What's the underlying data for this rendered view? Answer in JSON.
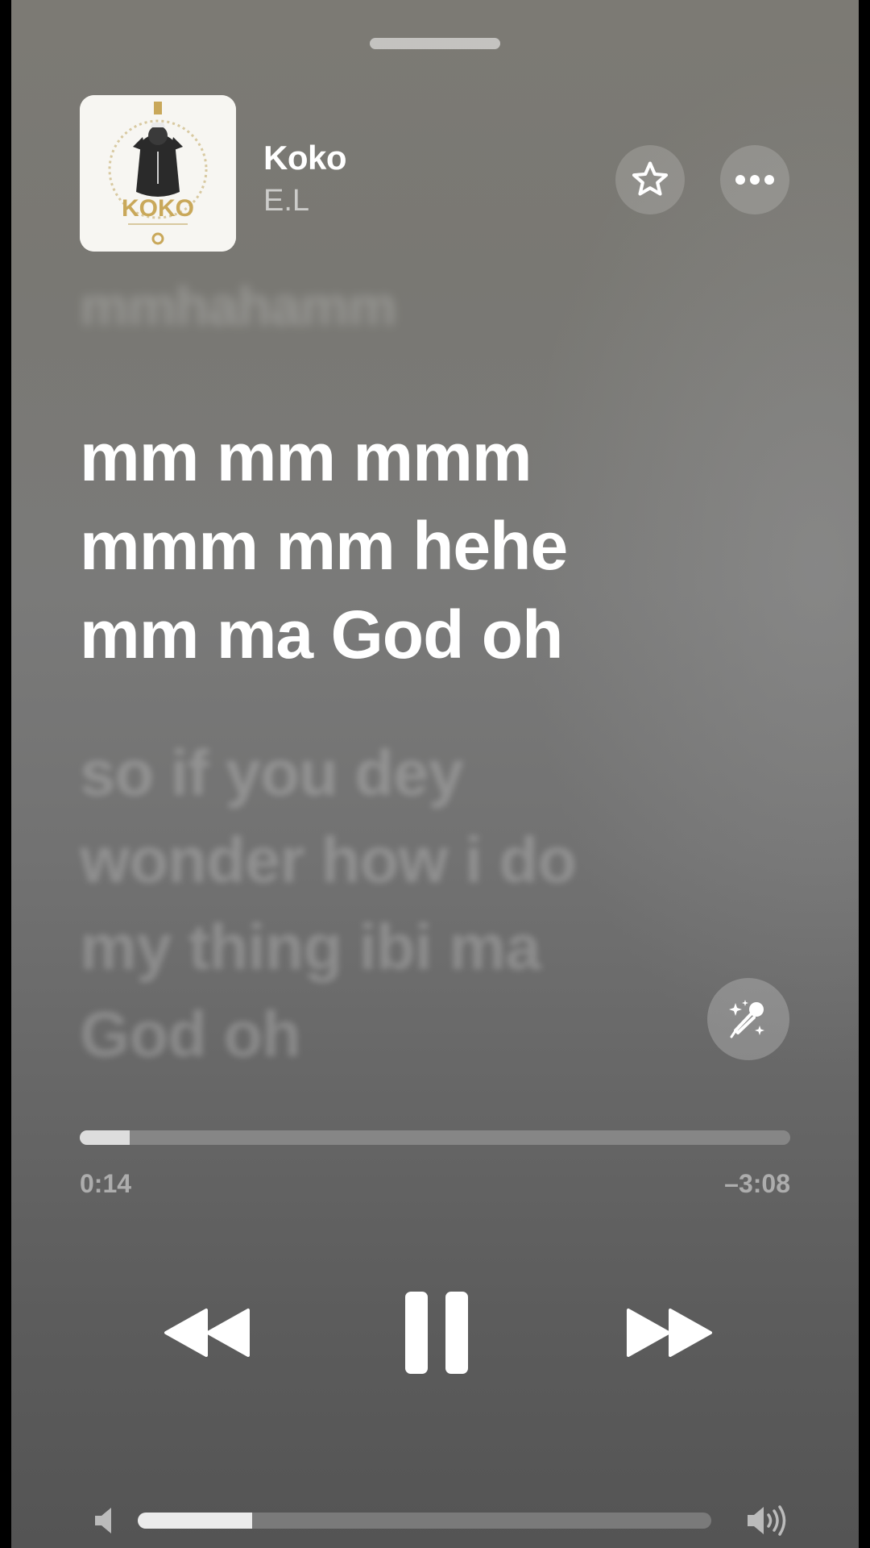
{
  "now_playing": {
    "title": "Koko",
    "artist": "E.L",
    "artwork": {
      "text": "KOKO",
      "description_icon": "album-artwork"
    }
  },
  "actions": {
    "favorite_icon": "star-icon",
    "more_icon": "ellipsis-icon",
    "lyrics_mode_icon": "microphone-sparkle-icon"
  },
  "lyrics": {
    "previous": "mmhahamm",
    "current": [
      "mm mm mmm",
      "mmm mm hehe",
      "mm ma God oh"
    ],
    "next": [
      "so if you dey",
      "wonder how i do",
      "my thing ibi ma",
      "God oh"
    ]
  },
  "playback": {
    "elapsed": "0:14",
    "remaining": "–3:08",
    "progress_fraction": 0.07,
    "state": "playing"
  },
  "controls": {
    "rewind_icon": "rewind-icon",
    "pause_icon": "pause-icon",
    "forward_icon": "fast-forward-icon"
  },
  "volume": {
    "level_fraction": 0.2,
    "low_icon": "speaker-low-icon",
    "high_icon": "speaker-high-icon"
  },
  "colors": {
    "text_primary": "#ffffff",
    "background_top": "#7c7a74",
    "background_bottom": "#545454"
  }
}
